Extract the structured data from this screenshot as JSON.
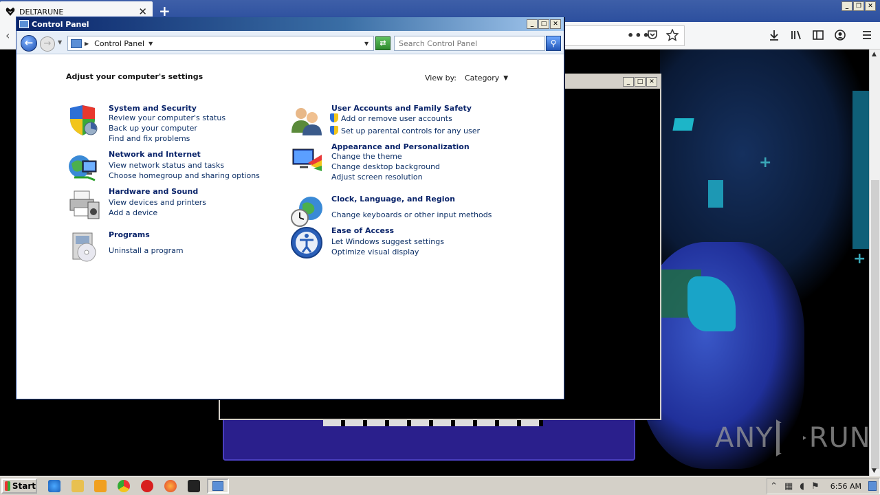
{
  "browser": {
    "tab_title": "DELTARUNE",
    "tab_close": "✕",
    "new_tab": "+",
    "url_dots": "•••",
    "tools": [
      "pocket-icon",
      "bookmark-star-icon",
      "download-icon",
      "library-icon",
      "sidebar-icon",
      "account-icon",
      "menu-icon"
    ]
  },
  "control_panel": {
    "window_title": "Control Panel",
    "breadcrumb": "Control Panel",
    "search_placeholder": "Search Control Panel",
    "heading": "Adjust your computer's settings",
    "view_by_label": "View by:",
    "view_by_value": "Category",
    "categories_left": [
      {
        "title": "System and Security",
        "icon": "shield-icon",
        "links": [
          "Review your computer's status",
          "Back up your computer",
          "Find and fix problems"
        ]
      },
      {
        "title": "Network and Internet",
        "icon": "network-globe-icon",
        "links": [
          "View network status and tasks",
          "Choose homegroup and sharing options"
        ]
      },
      {
        "title": "Hardware and Sound",
        "icon": "printer-icon",
        "links": [
          "View devices and printers",
          "Add a device"
        ]
      },
      {
        "title": "Programs",
        "icon": "programs-disc-icon",
        "links": [
          "Uninstall a program"
        ]
      }
    ],
    "categories_right": [
      {
        "title": "User Accounts and Family Safety",
        "icon": "users-icon",
        "links": [
          "Add or remove user accounts",
          "Set up parental controls for any user"
        ]
      },
      {
        "title": "Appearance and Personalization",
        "icon": "display-palette-icon",
        "links": [
          "Change the theme",
          "Change desktop background",
          "Adjust screen resolution"
        ]
      },
      {
        "title": "Clock, Language, and Region",
        "icon": "clock-globe-icon",
        "links": [
          "Change keyboards or other input methods"
        ]
      },
      {
        "title": "Ease of Access",
        "icon": "ease-of-access-icon",
        "links": [
          "Let Windows suggest settings",
          "Optimize visual display"
        ]
      }
    ]
  },
  "watermark": {
    "left": "ANY",
    "right": "RUN"
  },
  "taskbar": {
    "start_label": "Start",
    "clock": "6:56 AM"
  },
  "colors": {
    "titlebar": "#0a246a",
    "link": "#0c2f66",
    "game_panel": "#2a1f8c"
  }
}
